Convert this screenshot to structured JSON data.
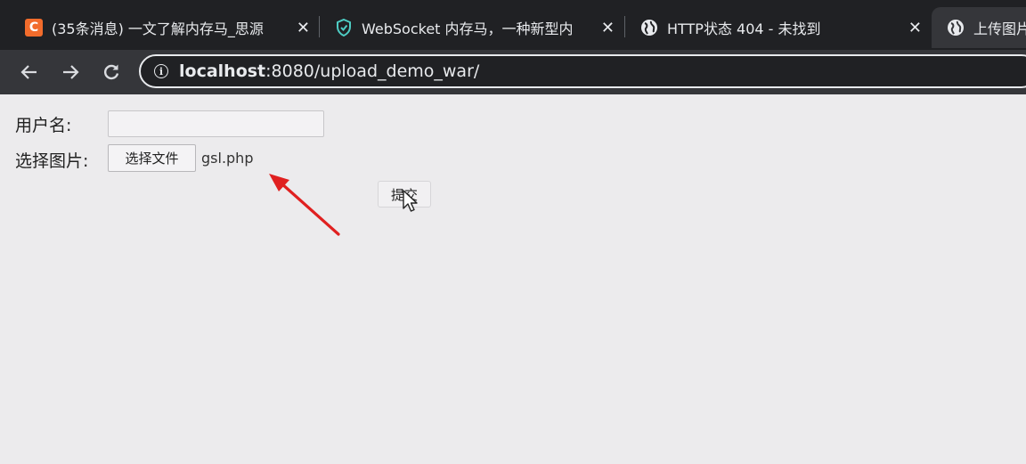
{
  "browser": {
    "tabs": [
      {
        "title": "(35条消息) 一文了解内存马_思源",
        "favicon": "csdn-icon",
        "favicon_text": "C",
        "active": false
      },
      {
        "title": "WebSocket 内存马，一种新型内",
        "favicon": "shield-icon",
        "active": false
      },
      {
        "title": "HTTP状态 404 - 未找到",
        "favicon": "globe-icon",
        "active": false
      },
      {
        "title": "上传图片",
        "favicon": "globe-icon",
        "active": true
      }
    ],
    "close_glyph": "✕",
    "address": {
      "host": "localhost",
      "path": ":8080/upload_demo_war/"
    }
  },
  "form": {
    "username_label": "用户名:",
    "username_value": "",
    "image_label": "选择图片:",
    "file_button_label": "选择文件",
    "selected_file": "gsl.php",
    "submit_label": "提交"
  },
  "annotation": {
    "arrow_color": "#e02020",
    "arrow_target": "selected-file-name"
  }
}
